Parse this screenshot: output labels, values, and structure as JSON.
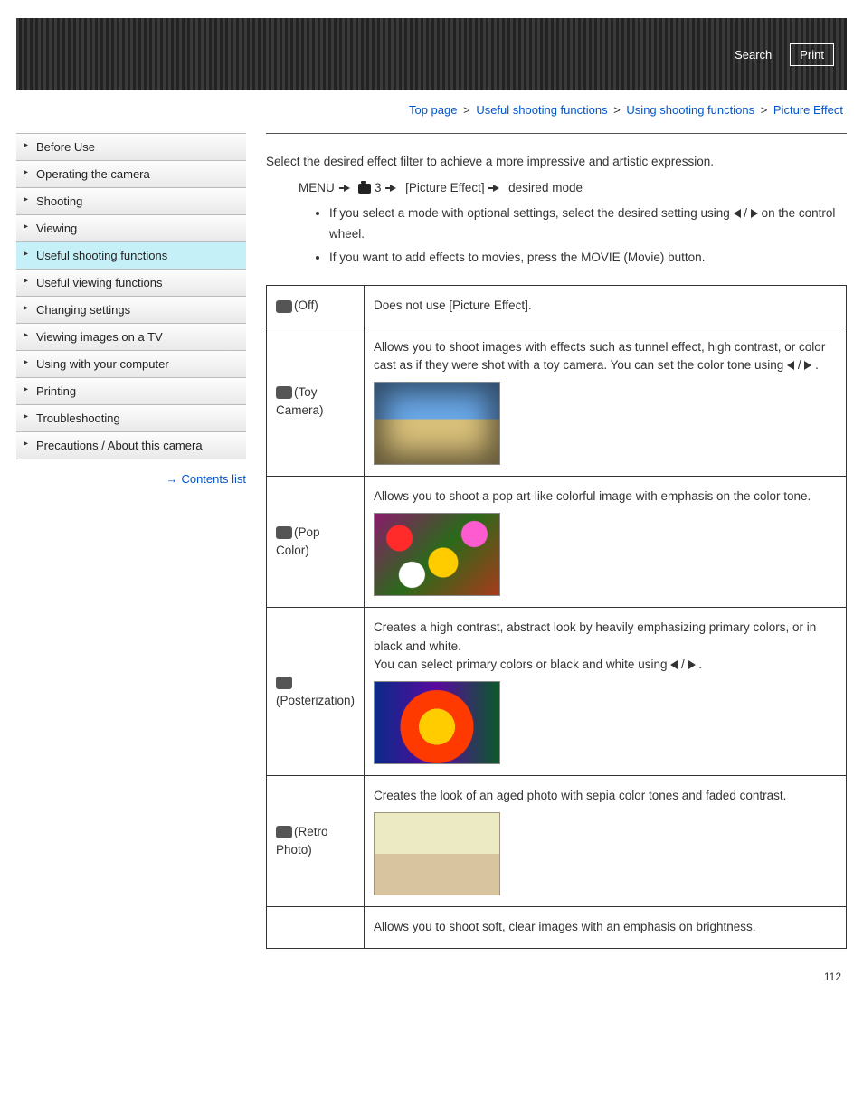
{
  "header": {
    "search": "Search",
    "print": "Print"
  },
  "breadcrumb": {
    "top": "Top page",
    "l1": "Useful shooting functions",
    "l2": "Using shooting functions",
    "current": "Picture Effect"
  },
  "sidebar": {
    "items": [
      "Before Use",
      "Operating the camera",
      "Shooting",
      "Viewing",
      "Useful shooting functions",
      "Useful viewing functions",
      "Changing settings",
      "Viewing images on a TV",
      "Using with your computer",
      "Printing",
      "Troubleshooting",
      "Precautions / About this camera"
    ],
    "contents_link": "Contents list"
  },
  "content": {
    "intro": "Select the desired effect filter to achieve a more impressive and artistic expression.",
    "menu_path": {
      "menu": "MENU",
      "num": "3",
      "pe": "[Picture Effect]",
      "dm": "desired mode"
    },
    "bullets": {
      "b1a": "If you select a mode with optional settings, select the desired setting using ",
      "b1b": " on the control wheel.",
      "b2": "If you want to add effects to movies, press the MOVIE (Movie) button."
    },
    "table": {
      "off": {
        "name": "(Off)",
        "desc": "Does not use [Picture Effect]."
      },
      "toy": {
        "name": "(Toy Camera)",
        "desc_a": "Allows you to shoot images with effects such as tunnel effect, high contrast, or color cast as if they were shot with a toy camera. You can set the color tone using ",
        "desc_b": "."
      },
      "pop": {
        "name": "(Pop Color)",
        "desc": "Allows you to shoot a pop art-like colorful image with emphasis on the color tone."
      },
      "poster": {
        "name": "(Posterization)",
        "desc_a": "Creates a high contrast, abstract look by heavily emphasizing primary colors, or in black and white.",
        "desc_b": "You can select primary colors or black and white using ",
        "desc_c": "."
      },
      "retro": {
        "name": "(Retro Photo)",
        "desc": "Creates the look of an aged photo with sepia color tones and faded contrast."
      },
      "soft": {
        "desc": "Allows you to shoot soft, clear images with an emphasis on brightness."
      }
    },
    "page_number": "112",
    "slash": " / "
  }
}
